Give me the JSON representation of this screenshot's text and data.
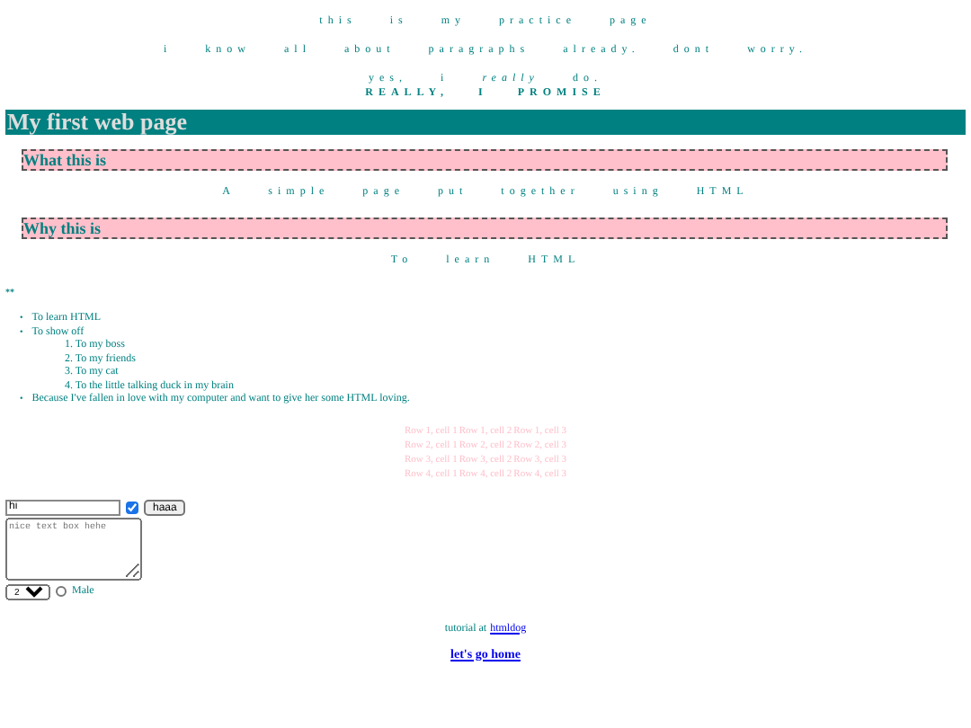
{
  "intro": {
    "lines": [
      "this is my practice page",
      "i know all about paragraphs already. dont worry.",
      "yes, i *really* do."
    ],
    "shout": "REALLY, I PROMISE"
  },
  "heading": "My first web page",
  "sections": [
    {
      "title": "What this is",
      "text": "A simple page put together using HTML"
    },
    {
      "title": "Why this is",
      "text": "To learn HTML"
    }
  ],
  "marker": "**",
  "reasons": [
    {
      "bullet": "•",
      "text": "To learn HTML"
    },
    {
      "bullet": "•",
      "text": "To show off",
      "children": [
        {
          "number": "1.",
          "text": "To my boss"
        },
        {
          "number": "2.",
          "text": "To my friends"
        },
        {
          "number": "3.",
          "text": "To my cat"
        },
        {
          "number": "4.",
          "text": "To the little talking duck in my brain"
        }
      ]
    },
    {
      "bullet": "•",
      "text": "Because I've fallen in love with my computer and want to give her some HTML loving."
    }
  ],
  "table": {
    "rows": [
      [
        "Row 1, cell 1",
        "Row 1, cell 2",
        "Row 1, cell 3"
      ],
      [
        "Row 2, cell 1",
        "Row 2, cell 2",
        "Row 2, cell 3"
      ],
      [
        "Row 3, cell 1",
        "Row 3, cell 2",
        "Row 3, cell 3"
      ],
      [
        "Row 4, cell 1",
        "Row 4, cell 2",
        "Row 4, cell 3"
      ]
    ]
  },
  "form": {
    "text_value": "hi",
    "checkbox": {
      "checked": true
    },
    "button": "haaa",
    "textarea": {
      "placeholder": "nice text box hehe"
    },
    "select": {
      "value": "2"
    },
    "radio": {
      "label": "Male",
      "checked": false
    }
  },
  "footer": {
    "text": "tutorial at",
    "link": "htmldog",
    "home": "let's go home"
  }
}
